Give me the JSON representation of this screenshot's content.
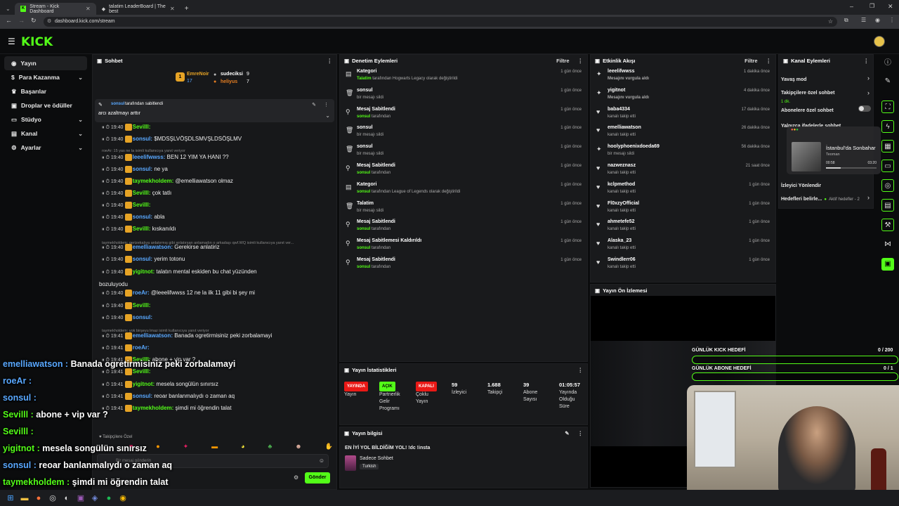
{
  "browser": {
    "tabs": [
      {
        "label": "Stream - Kick Dashboard"
      },
      {
        "label": "talatim LeaderBoard | The best"
      }
    ],
    "url": "dashboard.kick.com/stream"
  },
  "brand": {
    "logo": "KICK",
    "accent": "#53fc18"
  },
  "sidebar": {
    "items": [
      {
        "label": "Yayın",
        "icon": "broadcast-icon"
      },
      {
        "label": "Para Kazanma",
        "icon": "money-icon"
      },
      {
        "label": "Başarılar",
        "icon": "trophy-icon"
      },
      {
        "label": "Droplar ve ödüller",
        "icon": "gift-icon"
      },
      {
        "label": "Stüdyo",
        "icon": "monitor-icon"
      },
      {
        "label": "Kanal",
        "icon": "channel-icon"
      },
      {
        "label": "Ayarlar",
        "icon": "gear-icon"
      }
    ]
  },
  "chat": {
    "title": "Sohbet",
    "leaderboard": [
      {
        "name": "EmreNoir",
        "value": "17"
      },
      {
        "name": "sudeciksi",
        "value": "9"
      },
      {
        "name": "heliyus",
        "value": "7"
      }
    ],
    "pinned": {
      "user": "sonsul",
      "by": "tarafından sabitlendi",
      "text": "arcı azaltmayı arttır"
    },
    "messages": [
      {
        "time": "19:40",
        "user": "Sevilll:",
        "text": "",
        "color": "#53fc18"
      },
      {
        "time": "19:40",
        "user": "sonsul:",
        "text": "$MDSŞLVÖŞDLSMVŞLDSÖŞLMV",
        "color": "#59a8ff"
      },
      {
        "time": "19:40",
        "user": "leeelifwwss:",
        "text": "BEN 12 YIM YA HANI ??",
        "color": "#59a8ff"
      },
      {
        "time": "19:40",
        "user": "sonsul:",
        "text": "ne ya",
        "color": "#59a8ff"
      },
      {
        "time": "19:40",
        "user": "taymekholdem:",
        "text": "@emelliawatson olmaz",
        "color": "#53fc18"
      },
      {
        "time": "19:40",
        "user": "Sevilll:",
        "text": "çok tatlı",
        "color": "#53fc18"
      },
      {
        "time": "19:40",
        "user": "Sevilll:",
        "text": "",
        "color": "#53fc18"
      },
      {
        "time": "19:40",
        "user": "sonsul:",
        "text": "abla",
        "color": "#59a8ff"
      },
      {
        "time": "19:40",
        "user": "Sevilll:",
        "text": "kıskanıldı",
        "color": "#53fc18"
      },
      {
        "time": "19:40",
        "user": "emelliawatson:",
        "text": "Gerekirse anlatiriz",
        "color": "#59a8ff"
      },
      {
        "time": "19:40",
        "user": "sonsul:",
        "text": "yerim totonu",
        "color": "#59a8ff"
      },
      {
        "time": "19:40",
        "user": "yigitnot:",
        "text": "talatın mental eskiden bu chat yüzünden",
        "color": "#53fc18"
      },
      {
        "time": "19:40",
        "user": "roeAr:",
        "text": "@leeelifwwss 12 ne la ilk 11 gibi bi şey mi",
        "color": "#59a8ff"
      },
      {
        "time": "19:40",
        "user": "Sevilll:",
        "text": "",
        "color": "#53fc18"
      },
      {
        "time": "19:40",
        "user": "sonsul:",
        "text": "",
        "color": "#59a8ff"
      },
      {
        "time": "19:41",
        "user": "emelliawatson:",
        "text": "Banada ogretirmisiniz peki zorbalamayi",
        "color": "#59a8ff"
      },
      {
        "time": "19:41",
        "user": "roeAr:",
        "text": "",
        "color": "#59a8ff"
      },
      {
        "time": "19:41",
        "user": "Sevilll:",
        "text": "abone + vip var ?",
        "color": "#53fc18"
      },
      {
        "time": "19:41",
        "user": "Sevilll:",
        "text": "",
        "color": "#53fc18"
      },
      {
        "time": "19:41",
        "user": "yigitnot:",
        "text": "mesela songülün sınırsız",
        "color": "#53fc18"
      },
      {
        "time": "19:41",
        "user": "sonsul:",
        "text": "reoar banlanmalıydı o zaman aq",
        "color": "#59a8ff"
      },
      {
        "time": "19:41",
        "user": "taymekholdem:",
        "text": "şimdi mi öğrendin talat",
        "color": "#53fc18"
      }
    ],
    "wrap_text": "bozuluyodu",
    "sys_notes": [
      "roeAr: 15 yas ne la isimli kullanıcıya yanıt veriyor",
      "taymekholdem: gerizekalıya anlatırmış gibi anlatırsan anlamadın o arkadaşı qwf.WQ isimli kullanıcıya yanıt ver...",
      "taymekholdem: yok birşeyu lmaz isimli kullanıcıya yanıt veriyor"
    ],
    "input_placeholder": "Bir mesaj gönderin",
    "send_label": "Gönder",
    "followers_only": "Takipçilere Özel"
  },
  "overlay_chat": [
    {
      "user": "emelliawatson :",
      "text": "Banada ogretirmisiniz peki zorbalamayi",
      "color": "#59a8ff"
    },
    {
      "user": "roeAr :",
      "text": "",
      "color": "#59a8ff"
    },
    {
      "user": "sonsul :",
      "text": "",
      "color": "#59a8ff"
    },
    {
      "user": "Sevilll : ",
      "text": "abone + vip var ?",
      "color": "#53fc18"
    },
    {
      "user": "Sevilll :",
      "text": "",
      "color": "#53fc18"
    },
    {
      "user": "yigitnot :",
      "text": "mesela songülün sınırsız",
      "color": "#53fc18"
    },
    {
      "user": "sonsul :",
      "text": "reoar banlanmalıydı o zaman aq",
      "color": "#59a8ff"
    },
    {
      "user": "taymekholdem :",
      "text": "şimdi mi öğrendin talat",
      "color": "#53fc18"
    }
  ],
  "moderation": {
    "title": "Denetim Eylemleri",
    "filter": "Filtre",
    "rows": [
      {
        "icon": "category-icon",
        "title": "Kategori",
        "sub_user": "Talatim",
        "sub": " tarafından Hogwarts Legacy olarak değiştirildi",
        "time": "1 gün önce"
      },
      {
        "icon": "trash-icon",
        "title": "sonsul",
        "sub_user": "",
        "sub": "bir mesajı sildi",
        "time": "1 gün önce"
      },
      {
        "icon": "pin-icon",
        "title": "Mesaj Sabitlendi",
        "sub_user": "sonsul",
        "sub": " tarafından",
        "time": "1 gün önce"
      },
      {
        "icon": "trash-icon",
        "title": "sonsul",
        "sub_user": "",
        "sub": "bir mesajı sildi",
        "time": "1 gün önce"
      },
      {
        "icon": "trash-icon",
        "title": "sonsul",
        "sub_user": "",
        "sub": "bir mesajı sildi",
        "time": "1 gün önce"
      },
      {
        "icon": "pin-icon",
        "title": "Mesaj Sabitlendi",
        "sub_user": "sonsul",
        "sub": " tarafından",
        "time": "1 gün önce"
      },
      {
        "icon": "category-icon",
        "title": "Kategori",
        "sub_user": "sonsul",
        "sub": " tarafından League of Legends olarak değiştirildi",
        "time": "1 gün önce"
      },
      {
        "icon": "trash-icon",
        "title": "Talatim",
        "sub_user": "",
        "sub": "bir mesajı sildi",
        "time": "1 gün önce"
      },
      {
        "icon": "pin-icon",
        "title": "Mesaj Sabitlendi",
        "sub_user": "sonsul",
        "sub": " tarafından",
        "time": "1 gün önce"
      },
      {
        "icon": "unpin-icon",
        "title": "Mesaj Sabitlemesi Kaldırıldı",
        "sub_user": "sonsul",
        "sub": " tarafından",
        "time": "1 gün önce"
      },
      {
        "icon": "pin-icon",
        "title": "Mesaj Sabitlendi",
        "sub_user": "sonsul",
        "sub": " tarafından",
        "time": "1 gün önce"
      }
    ]
  },
  "activity": {
    "title": "Etkinlik Akışı",
    "filter": "Filtre",
    "rows": [
      {
        "icon": "highlight-icon",
        "title": "leeelifwwss",
        "sub": "Mesajını vurgula aldı",
        "green": true,
        "time": "1 dakika önce"
      },
      {
        "icon": "highlight-icon",
        "title": "yigitnot",
        "sub": "Mesajını vurgula aldı",
        "green": true,
        "time": "4 dakika önce"
      },
      {
        "icon": "heart-icon",
        "title": "baba4334",
        "sub": "kanalı takip etti",
        "green": false,
        "time": "17 dakika önce"
      },
      {
        "icon": "heart-icon",
        "title": "emelliawatson",
        "sub": "kanalı takip etti",
        "green": false,
        "time": "26 dakika önce"
      },
      {
        "icon": "highlight-icon",
        "title": "hoolyphoenixdoeda69",
        "sub": "bir mesajı sildi",
        "green": false,
        "time": "56 dakika önce"
      },
      {
        "icon": "heart-icon",
        "title": "nazweznasz",
        "sub": "kanalı takip etti",
        "green": false,
        "time": "21 saat önce"
      },
      {
        "icon": "heart-icon",
        "title": "kclpmethod",
        "sub": "kanalı takip etti",
        "green": false,
        "time": "1 gün önce"
      },
      {
        "icon": "heart-icon",
        "title": "Fl0xzyOfficial",
        "sub": "kanalı takip etti",
        "green": false,
        "time": "1 gün önce"
      },
      {
        "icon": "heart-icon",
        "title": "ahmetefe52",
        "sub": "kanalı takip etti",
        "green": false,
        "time": "1 gün önce"
      },
      {
        "icon": "heart-icon",
        "title": "Alaska_23",
        "sub": "kanalı takip etti",
        "green": false,
        "time": "1 gün önce"
      },
      {
        "icon": "heart-icon",
        "title": "Swindlerr06",
        "sub": "kanalı takip etti",
        "green": false,
        "time": "1 gün önce"
      }
    ]
  },
  "channel_actions": {
    "title": "Kanal Eylemleri",
    "items": [
      {
        "label": "Yavaş mod",
        "sub": ""
      },
      {
        "label": "Takipçilere özel sohbet",
        "sub": "1 dk."
      },
      {
        "label": "Abonelere özel sohbet",
        "sub": ""
      },
      {
        "label": "Yalnızca ifadelerle sohbet",
        "sub": ""
      },
      {
        "label": "İzleyici Yönlendir",
        "sub": ""
      },
      {
        "label": "Hedefleri belirle...",
        "sub": "Aktif hedefler - 2"
      }
    ]
  },
  "music": {
    "title": "İstanbul'da Sonbahar",
    "artist": "Teoman",
    "elapsed": "00:58",
    "total": "03:20",
    "progress": 0.29
  },
  "preview": {
    "title": "Yayın Ön İzlemesi"
  },
  "goals": [
    {
      "label": "GÜNLÜK KICK HEDEFİ",
      "value": "0 / 200"
    },
    {
      "label": "GÜNLÜK ABONE HEDEFİ",
      "value": "0 / 1"
    }
  ],
  "stats": {
    "title": "Yayın İstatistikleri",
    "items": [
      {
        "pill": "YAYINDA",
        "pill_color": "#e91916",
        "label": "Yayın"
      },
      {
        "pill": "AÇIK",
        "pill_color": "#53fc18",
        "label": "Partnerlik Gelir Programı"
      },
      {
        "pill": "KAPALI",
        "pill_color": "#e91916",
        "label": "Çoklu Yayın"
      },
      {
        "value": "59",
        "label": "İzleyici"
      },
      {
        "value": "1.688",
        "label": "Takipçi"
      },
      {
        "value": "39",
        "label": "Abone Sayısı"
      },
      {
        "value": "01:05:57",
        "label": "Yayında Olduğu Süre"
      }
    ]
  },
  "stream_info": {
    "title": "Yayın bilgisi",
    "stream_title": "EN İYİ YOL BİLDİĞİM YOL! !dc !insta",
    "category": "Sadece Sohbet",
    "language": "Turkish"
  }
}
